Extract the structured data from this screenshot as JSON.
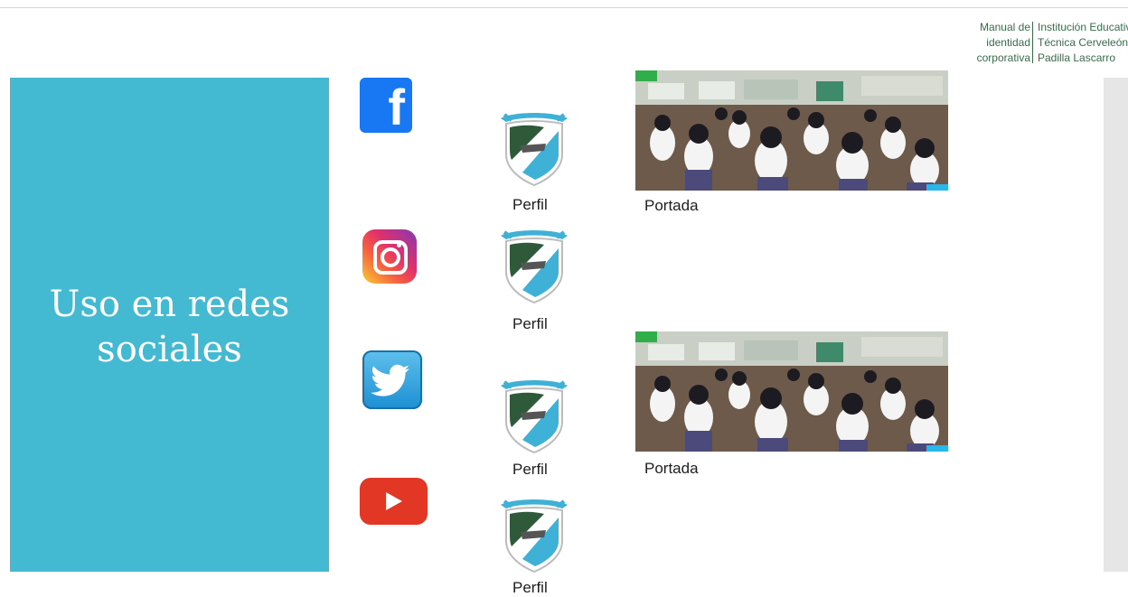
{
  "branding": {
    "left_lines": [
      "Manual de",
      "identidad",
      "corporativa"
    ],
    "right_lines": [
      "Institución Educativa",
      "Técnica Cerveleón",
      "Padilla Lascarro"
    ]
  },
  "section_title_lines": [
    "Uso en redes",
    "sociales"
  ],
  "social_networks": [
    {
      "icon": "facebook-icon",
      "profile_label": "Perfil",
      "cover_label": "Portada"
    },
    {
      "icon": "instagram-icon",
      "profile_label": "Perfil"
    },
    {
      "icon": "twitter-icon",
      "profile_label": "Perfil",
      "cover_label": "Portada"
    },
    {
      "icon": "youtube-icon",
      "profile_label": "Perfil"
    }
  ],
  "colors": {
    "panel": "#43b9d2",
    "brand_text": "#3a6b4b",
    "facebook": "#1877f2",
    "youtube": "#e23725"
  }
}
